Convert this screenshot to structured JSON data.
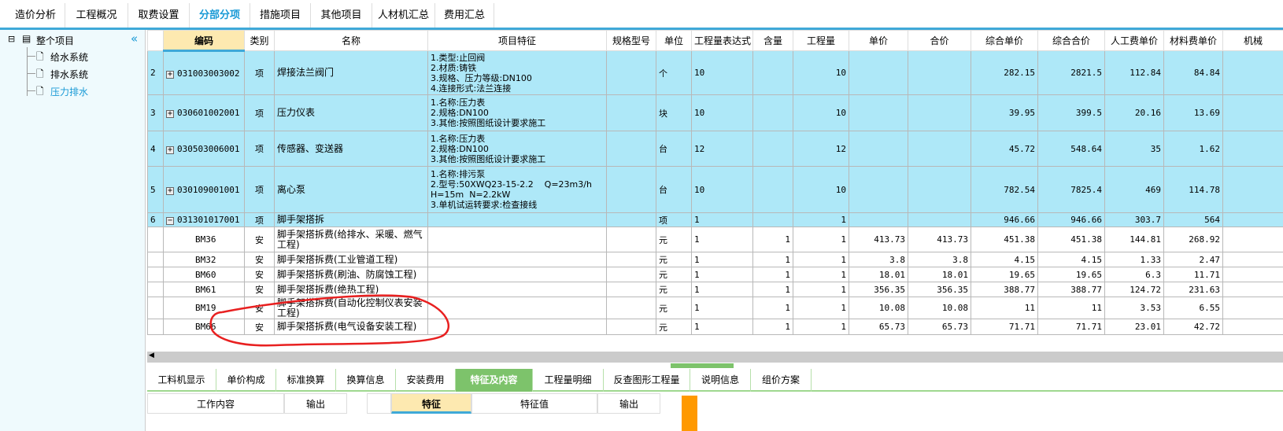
{
  "top_tabs": [
    "造价分析",
    "工程概况",
    "取费设置",
    "分部分项",
    "措施项目",
    "其他项目",
    "人材机汇总",
    "费用汇总"
  ],
  "active_top_tab": 3,
  "tree": {
    "root": "整个项目",
    "children": [
      "给水系统",
      "排水系统",
      "压力排水"
    ],
    "selected": 2,
    "collapse_icon": "«"
  },
  "columns": [
    "",
    "编码",
    "类别",
    "名称",
    "项目特征",
    "规格型号",
    "单位",
    "工程量表达式",
    "含量",
    "工程量",
    "单价",
    "合价",
    "综合单价",
    "综合合价",
    "人工费单价",
    "材料费单价",
    "机械"
  ],
  "rows": [
    {
      "type": "item",
      "no": "2",
      "code": "031003003002",
      "cat": "项",
      "name": "焊接法兰阀门",
      "feat": "1.类型:止回阀\n2.材质:铸铁\n3.规格、压力等级:DN100\n4.连接形式:法兰连接",
      "spec": "",
      "unit": "个",
      "expr": "10",
      "content": "",
      "qty": "10",
      "price": "",
      "total": "",
      "cprice": "282.15",
      "ctotal": "2821.5",
      "labor": "112.84",
      "mat": "84.84"
    },
    {
      "type": "item",
      "no": "3",
      "code": "030601002001",
      "cat": "项",
      "name": "压力仪表",
      "feat": "1.名称:压力表\n2.规格:DN100\n3.其他:按照图纸设计要求施工",
      "spec": "",
      "unit": "块",
      "expr": "10",
      "content": "",
      "qty": "10",
      "price": "",
      "total": "",
      "cprice": "39.95",
      "ctotal": "399.5",
      "labor": "20.16",
      "mat": "13.69"
    },
    {
      "type": "item",
      "no": "4",
      "code": "030503006001",
      "cat": "项",
      "name": "传感器、变送器",
      "feat": "1.名称:压力表\n2.规格:DN100\n3.其他:按照图纸设计要求施工",
      "spec": "",
      "unit": "台",
      "expr": "12",
      "content": "",
      "qty": "12",
      "price": "",
      "total": "",
      "cprice": "45.72",
      "ctotal": "548.64",
      "labor": "35",
      "mat": "1.62"
    },
    {
      "type": "item",
      "no": "5",
      "code": "030109001001",
      "cat": "项",
      "name": "离心泵",
      "feat": "1.名称:排污泵\n2.型号:50XWQ23-15-2.2    Q=23m3/h\nH=15m  N=2.2kW\n3.单机试运转要求:检查接线",
      "spec": "",
      "unit": "台",
      "expr": "10",
      "content": "",
      "qty": "10",
      "price": "",
      "total": "",
      "cprice": "782.54",
      "ctotal": "7825.4",
      "labor": "469",
      "mat": "114.78"
    },
    {
      "type": "item",
      "no": "6",
      "code": "031301017001",
      "cat": "项",
      "name": "脚手架搭拆",
      "feat": "",
      "spec": "",
      "unit": "项",
      "expr": "1",
      "content": "",
      "qty": "1",
      "price": "",
      "total": "",
      "cprice": "946.66",
      "ctotal": "946.66",
      "labor": "303.7",
      "mat": "564",
      "expanded": true
    },
    {
      "type": "sub",
      "no": "",
      "code": "BM36",
      "cat": "安",
      "name": "脚手架搭拆费(给排水、采暖、燃气\n工程)",
      "feat": "",
      "spec": "",
      "unit": "元",
      "expr": "1",
      "content": "1",
      "qty": "1",
      "price": "413.73",
      "total": "413.73",
      "cprice": "451.38",
      "ctotal": "451.38",
      "labor": "144.81",
      "mat": "268.92"
    },
    {
      "type": "sub",
      "no": "",
      "code": "BM32",
      "cat": "安",
      "name": "脚手架搭拆费(工业管道工程)",
      "feat": "",
      "spec": "",
      "unit": "元",
      "expr": "1",
      "content": "1",
      "qty": "1",
      "price": "3.8",
      "total": "3.8",
      "cprice": "4.15",
      "ctotal": "4.15",
      "labor": "1.33",
      "mat": "2.47"
    },
    {
      "type": "sub",
      "no": "",
      "code": "BM60",
      "cat": "安",
      "name": "脚手架搭拆费(刷油、防腐蚀工程)",
      "feat": "",
      "spec": "",
      "unit": "元",
      "expr": "1",
      "content": "1",
      "qty": "1",
      "price": "18.01",
      "total": "18.01",
      "cprice": "19.65",
      "ctotal": "19.65",
      "labor": "6.3",
      "mat": "11.71"
    },
    {
      "type": "sub",
      "no": "",
      "code": "BM61",
      "cat": "安",
      "name": "脚手架搭拆费(绝热工程)",
      "feat": "",
      "spec": "",
      "unit": "元",
      "expr": "1",
      "content": "1",
      "qty": "1",
      "price": "356.35",
      "total": "356.35",
      "cprice": "388.77",
      "ctotal": "388.77",
      "labor": "124.72",
      "mat": "231.63"
    },
    {
      "type": "sub",
      "no": "",
      "code": "BM19",
      "cat": "安",
      "name": "脚手架搭拆费(自动化控制仪表安装\n工程)",
      "feat": "",
      "spec": "",
      "unit": "元",
      "expr": "1",
      "content": "1",
      "qty": "1",
      "price": "10.08",
      "total": "10.08",
      "cprice": "11",
      "ctotal": "11",
      "labor": "3.53",
      "mat": "6.55"
    },
    {
      "type": "sub",
      "no": "",
      "code": "BM66",
      "cat": "安",
      "name": "脚手架搭拆费(电气设备安装工程)",
      "feat": "",
      "spec": "",
      "unit": "元",
      "expr": "1",
      "content": "1",
      "qty": "1",
      "price": "65.73",
      "total": "65.73",
      "cprice": "71.71",
      "ctotal": "71.71",
      "labor": "23.01",
      "mat": "42.72"
    }
  ],
  "bottom_tabs": [
    "工料机显示",
    "单价构成",
    "标准换算",
    "换算信息",
    "安装费用",
    "特征及内容",
    "工程量明细",
    "反查图形工程量",
    "说明信息",
    "组价方案"
  ],
  "active_bottom_tab": 5,
  "sub_left": {
    "work": "工作内容",
    "output": "输出"
  },
  "sub_right": {
    "feature": "特征",
    "value": "特征值",
    "output": "输出"
  },
  "colors": {
    "accent": "#3fa9d8",
    "row_highlight": "#aee8f8",
    "tab_green": "#7dc36b",
    "annotation": "#e82020"
  }
}
